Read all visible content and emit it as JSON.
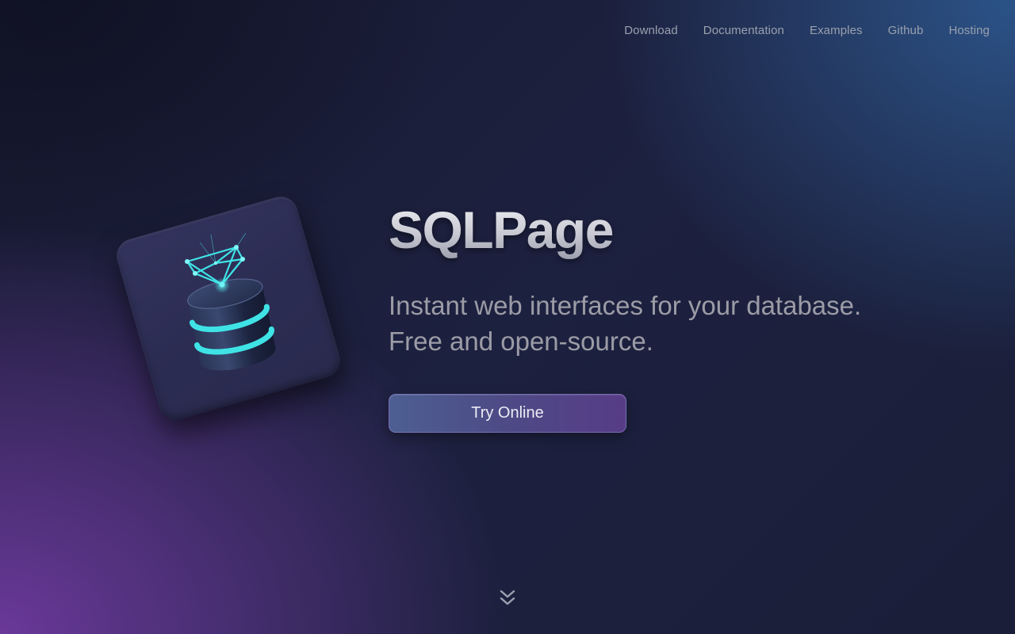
{
  "nav": {
    "items": [
      {
        "label": "Download"
      },
      {
        "label": "Documentation"
      },
      {
        "label": "Examples"
      },
      {
        "label": "Github"
      },
      {
        "label": "Hosting"
      }
    ]
  },
  "hero": {
    "logo_icon": "database-network-icon",
    "title": "SQLPage",
    "subtitle_line1": "Instant web interfaces for your database.",
    "subtitle_line2": "Free and open-source.",
    "cta_label": "Try Online",
    "scroll_icon": "double-chevron-down-icon"
  },
  "colors": {
    "accent_cyan": "#3fe3e6",
    "button_start": "#4d5f92",
    "button_end": "#573c86",
    "nav_text": "#9aa0ae",
    "subtitle_text": "#9c9ca6"
  }
}
